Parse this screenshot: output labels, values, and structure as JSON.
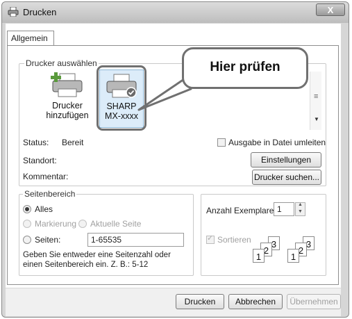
{
  "window": {
    "title": "Drucken",
    "close_label": "X"
  },
  "tabs": [
    {
      "label": "Allgemein"
    }
  ],
  "printer_group": {
    "legend": "Drucker auswählen",
    "items": [
      {
        "label_line1": "Drucker",
        "label_line2": "hinzufügen"
      },
      {
        "label_line1": "SHARP",
        "label_line2": "MX-xxxx"
      }
    ],
    "status_label": "Status:",
    "status_value": "Bereit",
    "location_label": "Standort:",
    "comment_label": "Kommentar:",
    "print_to_file_label": "Ausgabe in Datei umleiten",
    "settings_button": "Einstellungen",
    "find_printer_button": "Drucker suchen..."
  },
  "page_range": {
    "legend": "Seitenbereich",
    "all_label": "Alles",
    "selection_label": "Markierung",
    "current_page_label": "Aktuelle Seite",
    "pages_label": "Seiten:",
    "pages_value": "1-65535",
    "hint": "Geben Sie entweder eine Seitenzahl oder einen Seitenbereich ein. Z. B.: 5-12"
  },
  "copies": {
    "count_label": "Anzahl Exemplare:",
    "count_value": "1",
    "collate_label": "Sortieren",
    "page_numbers": [
      "1",
      "2",
      "3"
    ]
  },
  "footer": {
    "print_button": "Drucken",
    "cancel_button": "Abbrechen",
    "apply_button": "Übernehmen"
  },
  "callout": {
    "text": "Hier prüfen"
  },
  "colors": {
    "callout_border": "#707070",
    "selection_bg": "#dcecf9"
  }
}
